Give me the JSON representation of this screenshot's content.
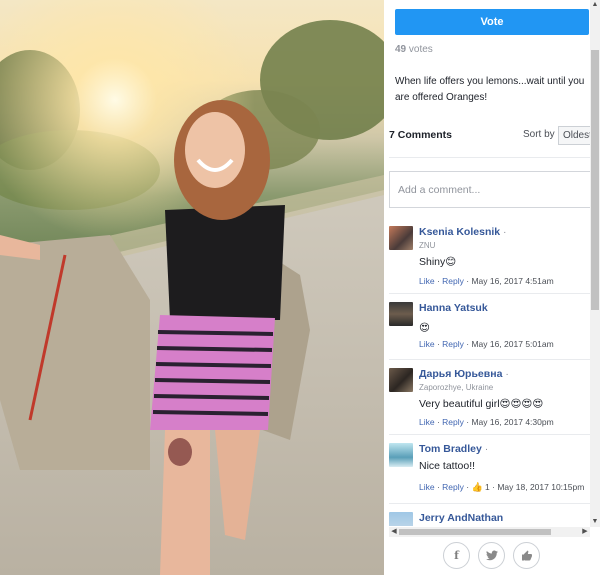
{
  "vote": {
    "button_label": "Vote",
    "count": "49",
    "count_suffix": "votes"
  },
  "caption": "When life offers you lemons...wait until you are offered Oranges!",
  "comments_header": {
    "count_label": "7 Comments",
    "sort_label": "Sort by",
    "sort_value": "Oldest"
  },
  "comment_box": {
    "placeholder": "Add a comment..."
  },
  "comments": [
    {
      "name": "Ksenia Kolesnik",
      "meta": "ZNU",
      "text": "Shiny😊",
      "like": "Like",
      "reply": "Reply",
      "time": "May 16, 2017 4:51am"
    },
    {
      "name": "Hanna Yatsuk",
      "meta": "",
      "text": "😍",
      "like": "Like",
      "reply": "Reply",
      "time": "May 16, 2017 5:01am"
    },
    {
      "name": "Дарья Юрьевна",
      "meta": "Zaporozhye, Ukraine",
      "text": "Very beautiful girl😍😍😍😍",
      "like": "Like",
      "reply": "Reply",
      "time": "May 16, 2017 4:30pm"
    },
    {
      "name": "Tom Bradley",
      "meta": "",
      "text": "Nice tattoo!!",
      "like": "Like",
      "reply": "Reply",
      "likes_count": "1",
      "time": "May 18, 2017 10:15pm"
    },
    {
      "name": "Jerry AndNathan",
      "meta": "",
      "text": "",
      "like": "",
      "reply": "",
      "time": ""
    }
  ],
  "share": {
    "facebook": "f",
    "twitter": "t",
    "like": "like"
  },
  "colors": {
    "accent": "#2196f3",
    "link": "#365899"
  }
}
